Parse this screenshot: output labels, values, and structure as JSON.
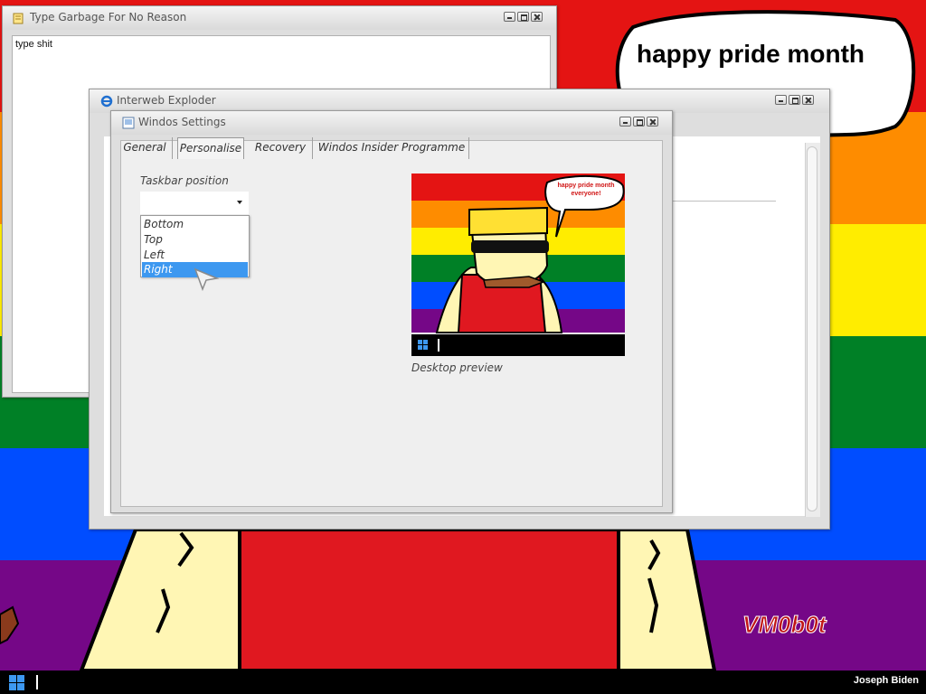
{
  "colors": {
    "rainbow": [
      "#e41413",
      "#fe8c00",
      "#ffed00",
      "#008026",
      "#004dff",
      "#750787"
    ],
    "taskbar": "#000000",
    "selection": "#3d98f0",
    "speech_text": "#d01515",
    "watermark": "#c01414"
  },
  "wallpaper": {
    "speech_text": "happy pride month",
    "signature": "VM0b0t"
  },
  "notepad": {
    "title": "Type Garbage For No Reason",
    "icon": "notepad-icon",
    "content": "type shit"
  },
  "browser": {
    "title": "Interweb Exploder",
    "icon": "ie-icon"
  },
  "settings": {
    "title": "Windos Settings",
    "icon": "settings-window-icon",
    "tabs": [
      "General",
      "Personalise",
      "Recovery",
      "Windos Insider Programme"
    ],
    "selected_tab": "Personalise",
    "taskbar_position_label": "Taskbar position",
    "taskbar_position_value": "",
    "taskbar_position_options": [
      "Bottom",
      "Top",
      "Left",
      "Right"
    ],
    "highlighted_option": "Right",
    "preview": {
      "speech": "happy pride month everyone!",
      "label": "Desktop preview"
    }
  },
  "taskbar": {
    "start_icon": "windows-logo-icon",
    "user": "Joseph Biden"
  }
}
